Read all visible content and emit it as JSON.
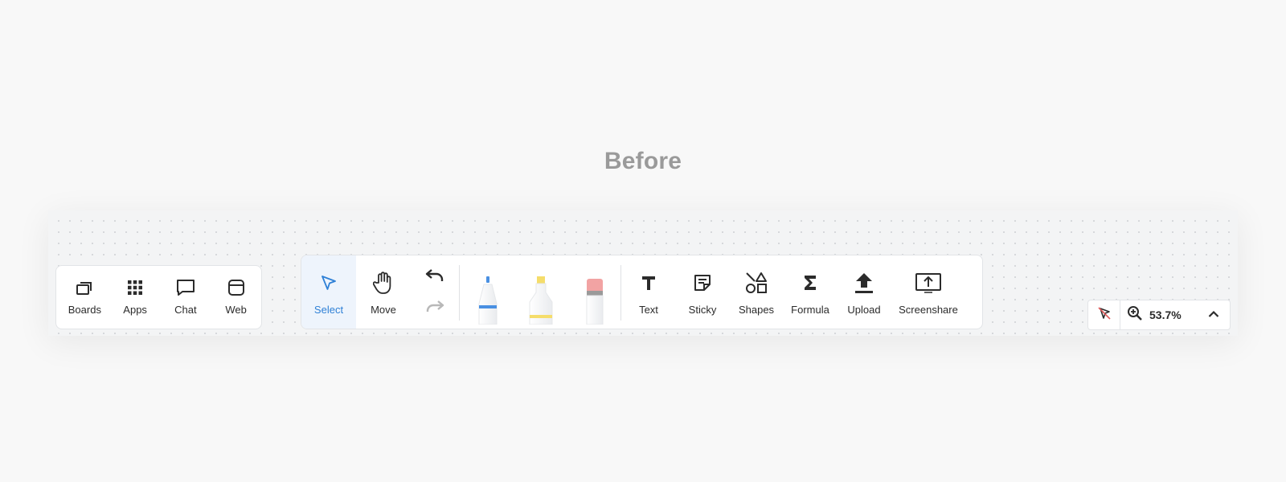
{
  "heading": "Before",
  "nav": {
    "items": [
      {
        "label": "Boards",
        "icon": "boards-icon"
      },
      {
        "label": "Apps",
        "icon": "apps-grid-icon"
      },
      {
        "label": "Chat",
        "icon": "chat-bubble-icon"
      },
      {
        "label": "Web",
        "icon": "browser-window-icon"
      }
    ]
  },
  "toolbar": {
    "select_label": "Select",
    "move_label": "Move",
    "undo_icon": "undo-icon",
    "redo_icon": "redo-icon",
    "pens": [
      {
        "name": "pen-tool",
        "accent": "#4a90e2"
      },
      {
        "name": "highlighter-tool",
        "accent": "#f5dd6b"
      },
      {
        "name": "eraser-tool",
        "accent": "#f2a3a3"
      }
    ],
    "text_label": "Text",
    "sticky_label": "Sticky",
    "shapes_label": "Shapes",
    "formula_label": "Formula",
    "upload_label": "Upload",
    "screenshare_label": "Screenshare",
    "active_tool": "Select"
  },
  "zoom": {
    "level": "53.7%",
    "pointer_icon": "pointer-off-icon",
    "zoom_icon": "zoom-in-icon",
    "toggle_icon": "chevron-up-icon"
  },
  "colors": {
    "accent": "#2f80d6",
    "active_bg": "#eef4fc",
    "text": "#2b2b2b",
    "heading": "#9a9a9a"
  }
}
